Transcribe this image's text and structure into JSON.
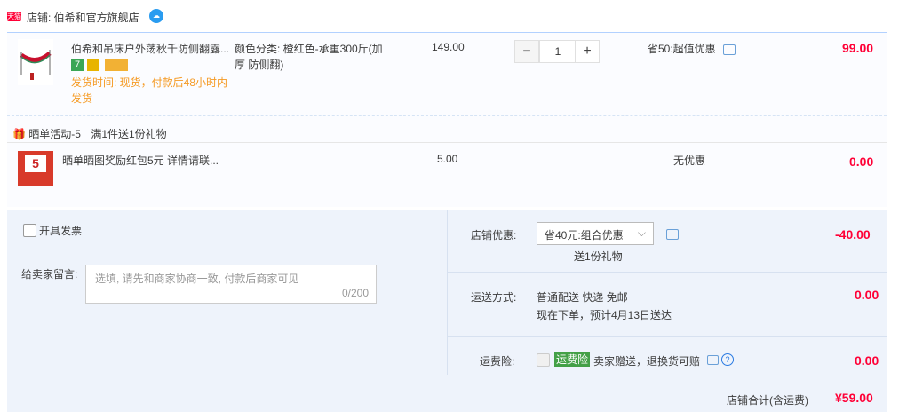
{
  "shop": {
    "badge": "天猫",
    "name": "店铺:  伯希和官方旗舰店"
  },
  "product": {
    "title": "伯希和吊床户外荡秋千防侧翻露...",
    "ship_label": "发货时间:  现货，付款后48小时内发货",
    "spec_label": "颜色分类:  橙红色-承重300斤(加厚 防侧翻)",
    "price": "149.00",
    "qty": "1",
    "discount": "省50:超值优惠",
    "subtotal": "99.00"
  },
  "gift": {
    "promo_label": "晒单活动-5",
    "promo_desc": "满1件送1份礼物",
    "title": "晒单晒图奖励红包5元 详情请联...",
    "price": "5.00",
    "discount": "无优惠",
    "subtotal": "0.00",
    "thumb_num": "5"
  },
  "invoice": {
    "label": "开具发票"
  },
  "message": {
    "label": "给卖家留言:",
    "placeholder": "选填, 请先和商家协商一致, 付款后商家可见",
    "counter": "0/200"
  },
  "shop_discount": {
    "label": "店铺优惠:",
    "selected": "省40元:组合优惠",
    "gift_note": "送1份礼物",
    "amount": "-40.00"
  },
  "shipping": {
    "label": "运送方式:",
    "method": "普通配送 快递 免邮",
    "eta": "现在下单，预计4月13日送达",
    "amount": "0.00"
  },
  "insurance": {
    "label": "运费险:",
    "tag": "运费险",
    "desc": "卖家赠送，退换货可赔",
    "amount": "0.00"
  },
  "total": {
    "label": "店铺合计(含运费)",
    "amount": "¥59.00"
  }
}
